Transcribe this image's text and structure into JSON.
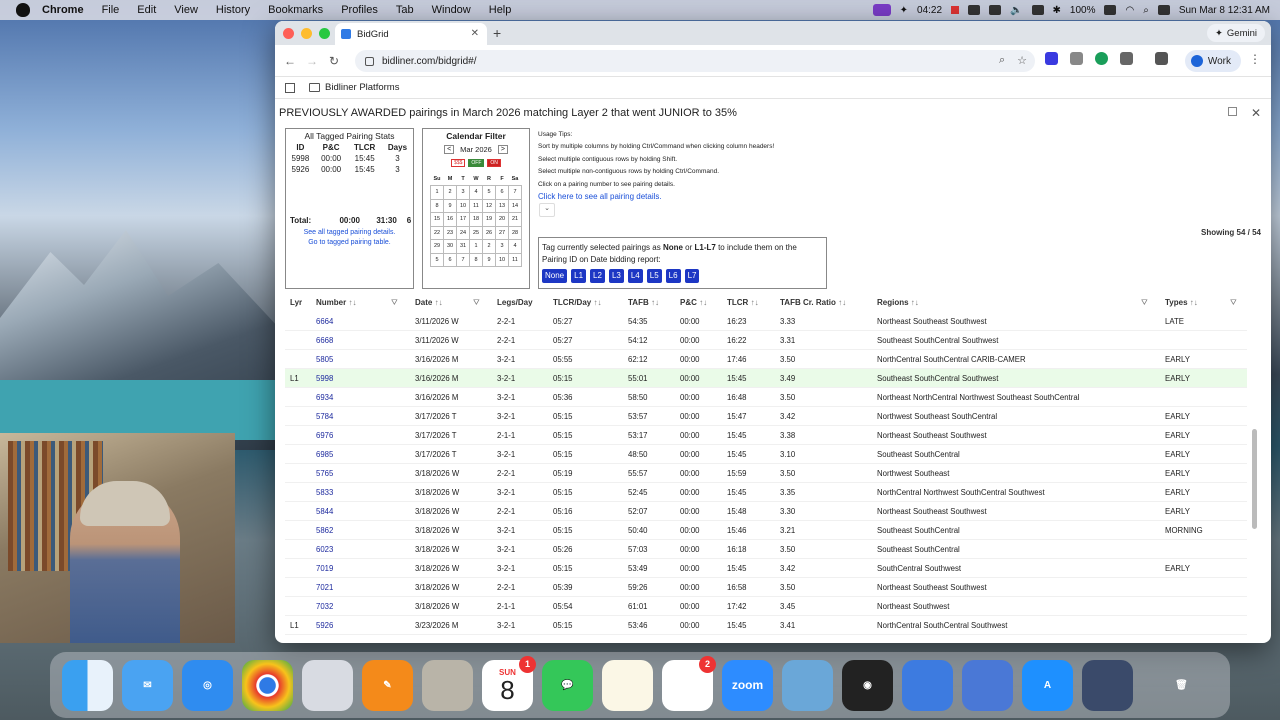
{
  "menubar": {
    "app": "Chrome",
    "items": [
      "File",
      "Edit",
      "View",
      "History",
      "Bookmarks",
      "Profiles",
      "Tab",
      "Window",
      "Help"
    ],
    "timer": "04:22",
    "battery": "100%",
    "datetime": "Sun Mar 8  12:31 AM"
  },
  "browser": {
    "tab_title": "BidGrid",
    "gemini_label": "Gemini",
    "url": "bidliner.com/bidgrid#/",
    "profile_label": "Work",
    "bookmark": "Bidliner Platforms"
  },
  "page": {
    "title": "PREVIOUSLY AWARDED pairings in March 2026 matching Layer 2 that went JUNIOR to 35%",
    "stats": {
      "heading": "All Tagged Pairing Stats",
      "columns": [
        "ID",
        "P&C",
        "TLCR",
        "Days"
      ],
      "rows": [
        [
          "5998",
          "00:00",
          "15:45",
          "3"
        ],
        [
          "5926",
          "00:00",
          "15:45",
          "3"
        ]
      ],
      "total_label": "Total:",
      "total": [
        "00:00",
        "31:30",
        "6"
      ],
      "link1": "See all tagged pairing details.",
      "link2": "Go to tagged pairing table."
    },
    "calendar": {
      "heading": "Calendar Filter",
      "prev": "<",
      "month": "Mar 2026",
      "next": ">",
      "toggle_dollar": "$$$",
      "toggle_off": "OFF",
      "toggle_on": "ON",
      "days": [
        "Su",
        "M",
        "T",
        "W",
        "R",
        "F",
        "Sa"
      ],
      "weeks": [
        [
          "1",
          "2",
          "3",
          "4",
          "5",
          "6",
          "7"
        ],
        [
          "8",
          "9",
          "10",
          "11",
          "12",
          "13",
          "14"
        ],
        [
          "15",
          "16",
          "17",
          "18",
          "19",
          "20",
          "21"
        ],
        [
          "22",
          "23",
          "24",
          "25",
          "26",
          "27",
          "28"
        ],
        [
          "29",
          "30",
          "31",
          "1",
          "2",
          "3",
          "4"
        ],
        [
          "5",
          "6",
          "7",
          "8",
          "9",
          "10",
          "11"
        ]
      ]
    },
    "tips": {
      "heading": "Usage Tips:",
      "lines": [
        "Sort by multiple columns by holding Ctrl/Command when clicking column headers!",
        "Select multiple contiguous rows by holding Shift.",
        "Select multiple non-contiguous rows by holding Ctrl/Command.",
        "Click on a pairing number to see pairing details."
      ],
      "link": "Click here to see all pairing details."
    },
    "tag": {
      "text_a": "Tag currently selected pairings as ",
      "none_word": "None",
      "text_b": " or ",
      "l_word": "L1-L7",
      "text_c": " to include them on the",
      "text_d": "Pairing ID on Date bidding report:",
      "buttons": [
        "None",
        "L1",
        "L2",
        "L3",
        "L4",
        "L5",
        "L6",
        "L7"
      ]
    },
    "showing": "Showing 54 / 54",
    "columns": [
      "Lyr",
      "Number",
      "Date",
      "Legs/Day",
      "TLCR/Day",
      "TAFB",
      "P&C",
      "TLCR",
      "TAFB Cr. Ratio",
      "Regions",
      "Types"
    ],
    "sort_glyph": "↑↓",
    "rows": [
      {
        "lyr": "",
        "num": "6664",
        "date": "3/11/2026 W",
        "legs": "2-2-1",
        "tlcrd": "05:27",
        "tafb": "54:35",
        "pc": "00:00",
        "tlcr": "16:23",
        "ratio": "3.33",
        "regions": "Northeast Southeast Southwest",
        "types": "LATE"
      },
      {
        "lyr": "",
        "num": "6668",
        "date": "3/11/2026 W",
        "legs": "2-2-1",
        "tlcrd": "05:27",
        "tafb": "54:12",
        "pc": "00:00",
        "tlcr": "16:22",
        "ratio": "3.31",
        "regions": "Southeast SouthCentral Southwest",
        "types": ""
      },
      {
        "lyr": "",
        "num": "5805",
        "date": "3/16/2026 M",
        "legs": "3-2-1",
        "tlcrd": "05:55",
        "tafb": "62:12",
        "pc": "00:00",
        "tlcr": "17:46",
        "ratio": "3.50",
        "regions": "NorthCentral SouthCentral CARIB-CAMER",
        "types": "EARLY"
      },
      {
        "lyr": "L1",
        "num": "5998",
        "date": "3/16/2026 M",
        "legs": "3-2-1",
        "tlcrd": "05:15",
        "tafb": "55:01",
        "pc": "00:00",
        "tlcr": "15:45",
        "ratio": "3.49",
        "regions": "Southeast SouthCentral Southwest",
        "types": "EARLY",
        "hl": true
      },
      {
        "lyr": "",
        "num": "6934",
        "date": "3/16/2026 M",
        "legs": "3-2-1",
        "tlcrd": "05:36",
        "tafb": "58:50",
        "pc": "00:00",
        "tlcr": "16:48",
        "ratio": "3.50",
        "regions": "Northeast NorthCentral Northwest Southeast SouthCentral",
        "types": ""
      },
      {
        "lyr": "",
        "num": "5784",
        "date": "3/17/2026 T",
        "legs": "3-2-1",
        "tlcrd": "05:15",
        "tafb": "53:57",
        "pc": "00:00",
        "tlcr": "15:47",
        "ratio": "3.42",
        "regions": "Northwest Southeast SouthCentral",
        "types": "EARLY"
      },
      {
        "lyr": "",
        "num": "6976",
        "date": "3/17/2026 T",
        "legs": "2-1-1",
        "tlcrd": "05:15",
        "tafb": "53:17",
        "pc": "00:00",
        "tlcr": "15:45",
        "ratio": "3.38",
        "regions": "Northeast Southeast Southwest",
        "types": "EARLY"
      },
      {
        "lyr": "",
        "num": "6985",
        "date": "3/17/2026 T",
        "legs": "3-2-1",
        "tlcrd": "05:15",
        "tafb": "48:50",
        "pc": "00:00",
        "tlcr": "15:45",
        "ratio": "3.10",
        "regions": "Southeast SouthCentral",
        "types": "EARLY"
      },
      {
        "lyr": "",
        "num": "5765",
        "date": "3/18/2026 W",
        "legs": "2-2-1",
        "tlcrd": "05:19",
        "tafb": "55:57",
        "pc": "00:00",
        "tlcr": "15:59",
        "ratio": "3.50",
        "regions": "Northwest Southeast",
        "types": "EARLY"
      },
      {
        "lyr": "",
        "num": "5833",
        "date": "3/18/2026 W",
        "legs": "3-2-1",
        "tlcrd": "05:15",
        "tafb": "52:45",
        "pc": "00:00",
        "tlcr": "15:45",
        "ratio": "3.35",
        "regions": "NorthCentral Northwest SouthCentral Southwest",
        "types": "EARLY"
      },
      {
        "lyr": "",
        "num": "5844",
        "date": "3/18/2026 W",
        "legs": "2-2-1",
        "tlcrd": "05:16",
        "tafb": "52:07",
        "pc": "00:00",
        "tlcr": "15:48",
        "ratio": "3.30",
        "regions": "Northeast Southeast Southwest",
        "types": "EARLY"
      },
      {
        "lyr": "",
        "num": "5862",
        "date": "3/18/2026 W",
        "legs": "3-2-1",
        "tlcrd": "05:15",
        "tafb": "50:40",
        "pc": "00:00",
        "tlcr": "15:46",
        "ratio": "3.21",
        "regions": "Southeast SouthCentral",
        "types": "MORNING"
      },
      {
        "lyr": "",
        "num": "6023",
        "date": "3/18/2026 W",
        "legs": "3-2-1",
        "tlcrd": "05:26",
        "tafb": "57:03",
        "pc": "00:00",
        "tlcr": "16:18",
        "ratio": "3.50",
        "regions": "Southeast SouthCentral",
        "types": ""
      },
      {
        "lyr": "",
        "num": "7019",
        "date": "3/18/2026 W",
        "legs": "3-2-1",
        "tlcrd": "05:15",
        "tafb": "53:49",
        "pc": "00:00",
        "tlcr": "15:45",
        "ratio": "3.42",
        "regions": "SouthCentral Southwest",
        "types": "EARLY"
      },
      {
        "lyr": "",
        "num": "7021",
        "date": "3/18/2026 W",
        "legs": "2-2-1",
        "tlcrd": "05:39",
        "tafb": "59:26",
        "pc": "00:00",
        "tlcr": "16:58",
        "ratio": "3.50",
        "regions": "Northeast Southeast Southwest",
        "types": ""
      },
      {
        "lyr": "",
        "num": "7032",
        "date": "3/18/2026 W",
        "legs": "2-1-1",
        "tlcrd": "05:54",
        "tafb": "61:01",
        "pc": "00:00",
        "tlcr": "17:42",
        "ratio": "3.45",
        "regions": "Northeast Southwest",
        "types": ""
      },
      {
        "lyr": "L1",
        "num": "5926",
        "date": "3/23/2026 M",
        "legs": "3-2-1",
        "tlcrd": "05:15",
        "tafb": "53:46",
        "pc": "00:00",
        "tlcr": "15:45",
        "ratio": "3.41",
        "regions": "NorthCentral SouthCentral Southwest",
        "types": ""
      }
    ]
  },
  "dock": {
    "calendar_month": "SUN",
    "calendar_day": "8",
    "messages_badge": "1",
    "reminders_badge": "2",
    "zoom_label": "zoom"
  }
}
